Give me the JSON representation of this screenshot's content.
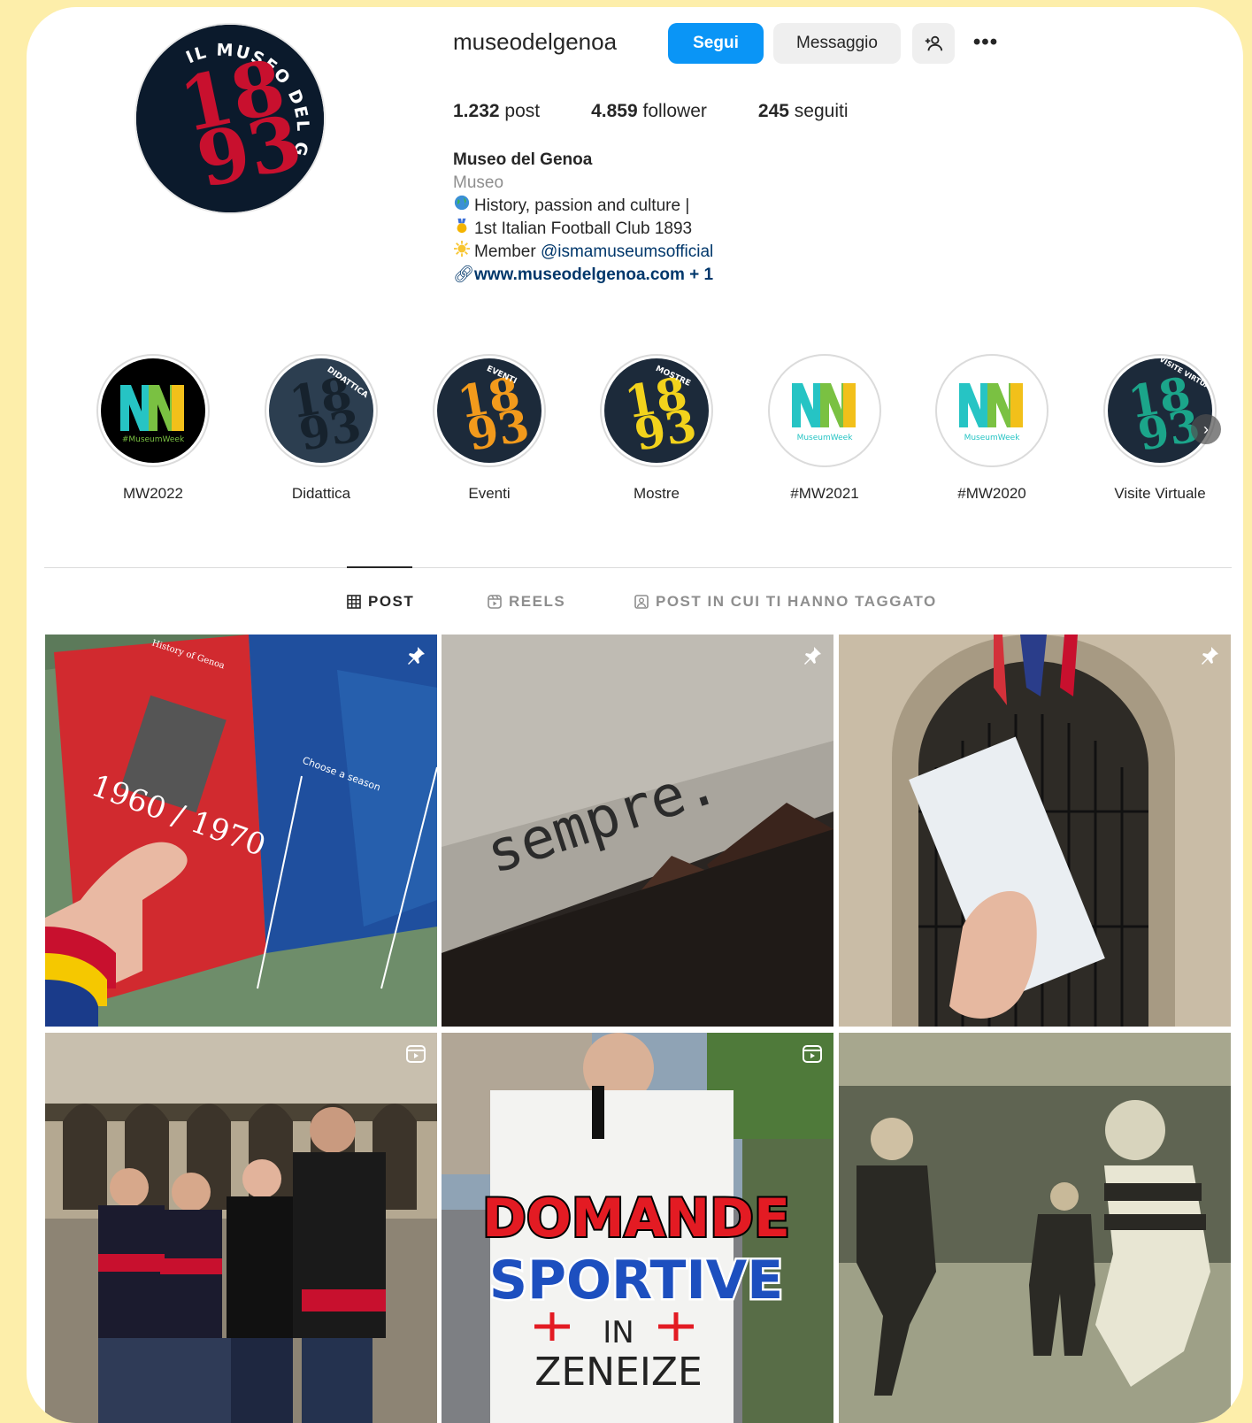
{
  "profile": {
    "username": "museodelgenoa",
    "follow_label": "Segui",
    "message_label": "Messaggio",
    "add_icon": "person-add-icon",
    "more_icon": "more-options-icon",
    "avatar_text_ring": "IL MUSEO DEL GENOA",
    "avatar_year_top": "18",
    "avatar_year_bottom": "93"
  },
  "stats": {
    "posts_count": "1.232",
    "posts_label": "post",
    "followers_count": "4.859",
    "followers_label": "follower",
    "following_count": "245",
    "following_label": "seguiti"
  },
  "bio": {
    "name": "Museo del Genoa",
    "category": "Museo",
    "line1": "History, passion and culture |",
    "line2": "1st Italian Football Club 1893",
    "line3_prefix": "Member",
    "line3_mention": "@ismamuseumsofficial",
    "link": "www.museodelgenoa.com",
    "link_more": " + 1"
  },
  "highlights": [
    {
      "label": "MW2022",
      "badge": "#MuseumWeek"
    },
    {
      "label": "Didattica",
      "badge": "DIDATTICA"
    },
    {
      "label": "Eventi",
      "badge": "EVENTI"
    },
    {
      "label": "Mostre",
      "badge": "MOSTRE"
    },
    {
      "label": "#MW2021",
      "badge": "MuseumWeek"
    },
    {
      "label": "#MW2020",
      "badge": "MuseumWeek"
    },
    {
      "label": "Visite Virtuale",
      "badge": "VISITE VIRTUALI"
    }
  ],
  "tabs": [
    {
      "label": "POST",
      "icon": "grid-icon",
      "active": true
    },
    {
      "label": "REELS",
      "icon": "reels-icon",
      "active": false
    },
    {
      "label": "POST IN CUI TI HANNO TAGGATO",
      "icon": "tagged-icon",
      "active": false
    }
  ],
  "posts": [
    {
      "kind": "pinned",
      "texts": [
        "1960 / 1970",
        "Choose a season",
        "History of Genoa"
      ]
    },
    {
      "kind": "pinned",
      "texts": [
        "sempre."
      ]
    },
    {
      "kind": "pinned",
      "texts": []
    },
    {
      "kind": "reel",
      "texts": []
    },
    {
      "kind": "reel",
      "texts": [
        "DOMANDE",
        "SPORTIVE",
        "IN",
        "ZENEIZE"
      ]
    },
    {
      "kind": "photo",
      "texts": []
    }
  ],
  "colors": {
    "accent": "#0a95f6",
    "genoa_red": "#c8102e",
    "genoa_navy": "#0b1a2c",
    "frame": "#fdeeaa"
  }
}
